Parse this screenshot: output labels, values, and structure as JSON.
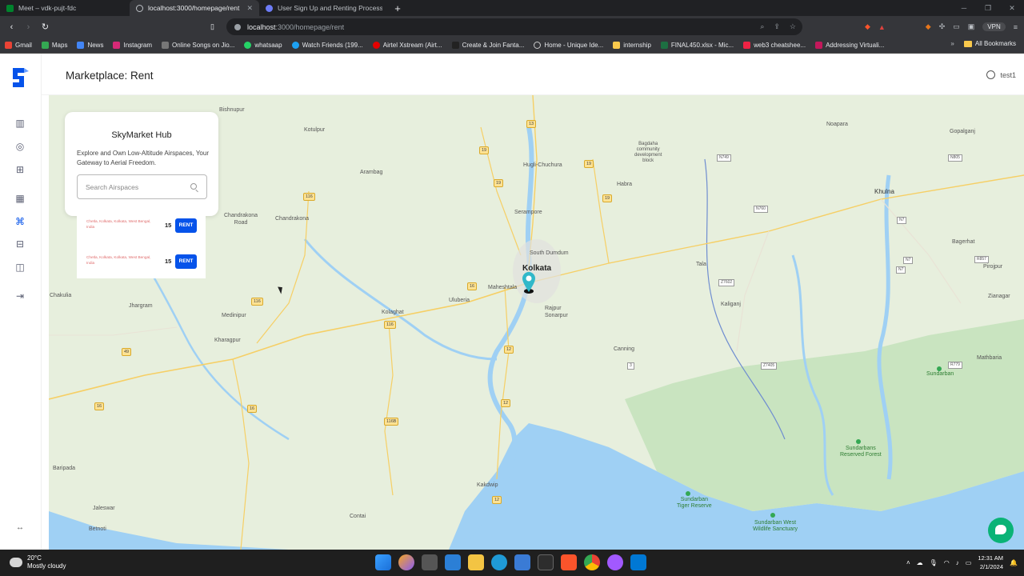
{
  "browser": {
    "tabs": [
      {
        "title": "Meet – vdk-pujt-fdc",
        "active": false
      },
      {
        "title": "localhost:3000/homepage/rent",
        "active": true
      },
      {
        "title": "User Sign Up and Renting Process",
        "active": false
      }
    ],
    "url_host": "localhost",
    "url_rest": ":3000/homepage/rent",
    "vpn_label": "VPN",
    "bookmarks": [
      "Gmail",
      "Maps",
      "News",
      "Instagram",
      "Online Songs on Jio...",
      "whatsaap",
      "Watch Friends (199...",
      "Airtel Xstream (Airt...",
      "Create & Join Fanta...",
      "Home - Unique Ide...",
      "internship",
      "FINAL450.xlsx - Mic...",
      "web3 cheatshee...",
      "Addressing Virtuali..."
    ],
    "all_bookmarks": "All Bookmarks"
  },
  "app": {
    "page_title": "Marketplace: Rent",
    "username": "test1",
    "panel": {
      "title": "SkyMarket Hub",
      "subtitle": "Explore and Own Low-Altitude Airspaces, Your Gateway to Aerial Freedom.",
      "search_placeholder": "Search Airspaces"
    },
    "listings": [
      {
        "address": "Chetla, Kolkata, Kolkata, West Bengal, India",
        "price": "15",
        "action": "RENT"
      },
      {
        "address": "Chetla, Kolkata, Kolkata, West Bengal, India",
        "price": "15",
        "action": "RENT"
      }
    ]
  },
  "map": {
    "places": {
      "kolkata": "Kolkata",
      "khulna": "Khulna",
      "hugli": "Hugli-Chuchura",
      "serampore": "Serampore",
      "south_dumdum": "South Dumdum",
      "maheshtala": "Maheshtala",
      "uluberia": "Uluberia",
      "rajpur": "Rajpur\nSonarpur",
      "habra": "Habra",
      "bagherhat": "Bagerhat",
      "medinipur": "Medinipur",
      "kharagpur": "Kharagpur",
      "kolaghat": "Kolaghat",
      "canning": "Canning",
      "kakdwip": "Kakdwip",
      "chandrakona_road": "Chandrakona\nRoad",
      "chandrakona": "Chandrakona",
      "arambag": "Arambag",
      "jhargram": "Jhargram",
      "baripada": "Baripada",
      "bishnupur": "Bishnupur",
      "kotulpur": "Kotulpur",
      "sundarban": "Sundarban",
      "sundarbans_reserved": "Sundarbans\nReserved Forest",
      "sundarban_tiger": "Sundarban\nTiger Reserve",
      "sundarban_west": "Sundarban West\nWildlife Sanctuary",
      "gopalganj": "Gopalganj",
      "pirojpur": "Pirojpur",
      "zianagar": "Zianagar",
      "mathbaria": "Mathbaria",
      "chakulia": "Chakulia",
      "jaleswar": "Jaleswar",
      "betnoti": "Betnoti",
      "contai": "Contai",
      "narail": "Noapara",
      "bagdaha": "Bagdaha\ncommunity\ndevelopment\nblock",
      "kaliganj": "Kaliganj",
      "tala": "Tala"
    }
  },
  "taskbar": {
    "temp": "20°C",
    "weather": "Mostly cloudy",
    "time": "12:31 AM",
    "date": "2/1/2024"
  }
}
